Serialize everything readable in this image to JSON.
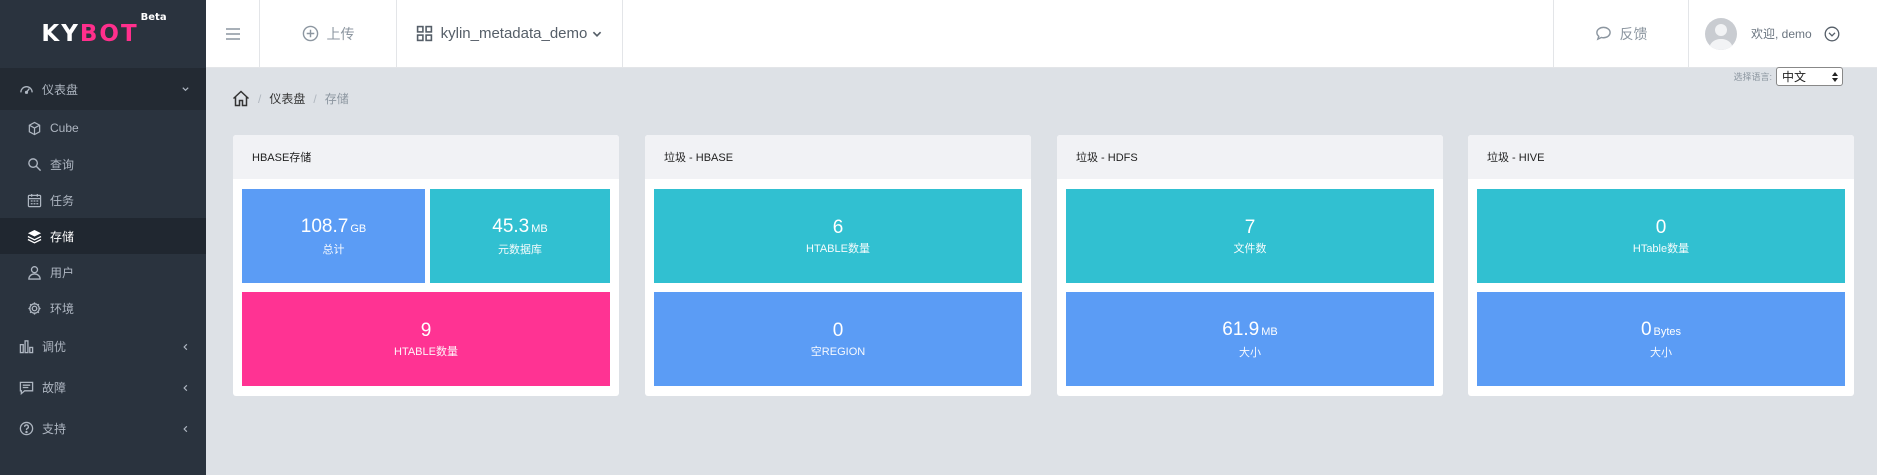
{
  "logo": {
    "part1": "KY",
    "part2": "BOT",
    "badge": "Beta"
  },
  "colors": {
    "sidebar": "#2a333e",
    "accent_pink": "#ff3393",
    "tile_blue": "#5b9cf5",
    "tile_teal": "#31c0d1",
    "background": "#dde1e6"
  },
  "sidebar": {
    "items": [
      {
        "label": "仪表盘",
        "icon": "dashboard-icon"
      },
      {
        "label": "Cube",
        "icon": "cube-icon"
      },
      {
        "label": "查询",
        "icon": "search-icon"
      },
      {
        "label": "任务",
        "icon": "calendar-icon"
      },
      {
        "label": "存储",
        "icon": "layers-icon"
      },
      {
        "label": "用户",
        "icon": "user-icon"
      },
      {
        "label": "环境",
        "icon": "gear-icon"
      },
      {
        "label": "调优",
        "icon": "bar-chart-icon"
      },
      {
        "label": "故障",
        "icon": "comment-icon"
      },
      {
        "label": "支持",
        "icon": "help-icon"
      }
    ]
  },
  "topbar": {
    "upload": "上传",
    "project": "kylin_metadata_demo",
    "feedback": "反馈",
    "user": "欢迎, demo"
  },
  "language": {
    "label": "选择语言:",
    "selected": "中文"
  },
  "breadcrumb": {
    "level1": "仪表盘",
    "level2": "存储"
  },
  "cards": {
    "hbase_storage": {
      "title": "HBASE存储",
      "total": {
        "value": "108.7",
        "unit": "GB",
        "label": "总计"
      },
      "metadata": {
        "value": "45.3",
        "unit": "MB",
        "label": "元数据库"
      },
      "htables": {
        "value": "9",
        "label": "HTABLE数量"
      }
    },
    "garbage_hbase": {
      "title": "垃圾 - HBASE",
      "htables": {
        "value": "6",
        "label": "HTABLE数量"
      },
      "empty_region": {
        "value": "0",
        "label": "空REGION"
      }
    },
    "garbage_hdfs": {
      "title": "垃圾 - HDFS",
      "files": {
        "value": "7",
        "label": "文件数"
      },
      "size": {
        "value": "61.9",
        "unit": "MB",
        "label": "大小"
      }
    },
    "garbage_hive": {
      "title": "垃圾 - HIVE",
      "htables": {
        "value": "0",
        "label": "HTable数量"
      },
      "size": {
        "value": "0",
        "unit": "Bytes",
        "label": "大小"
      }
    }
  }
}
